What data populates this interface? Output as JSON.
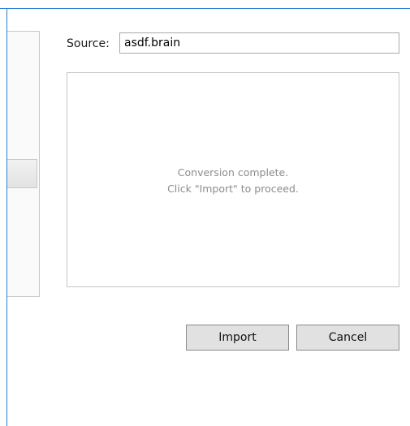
{
  "source": {
    "label": "Source:",
    "value": "asdf.brain"
  },
  "status": {
    "line1": "Conversion complete.",
    "line2": "Click \"Import\" to proceed."
  },
  "actions": {
    "import_label": "Import",
    "cancel_label": "Cancel"
  },
  "colors": {
    "accent_border": "#2b7fd6",
    "button_face": "#e1e1e1",
    "status_text": "#8c8c8c"
  }
}
